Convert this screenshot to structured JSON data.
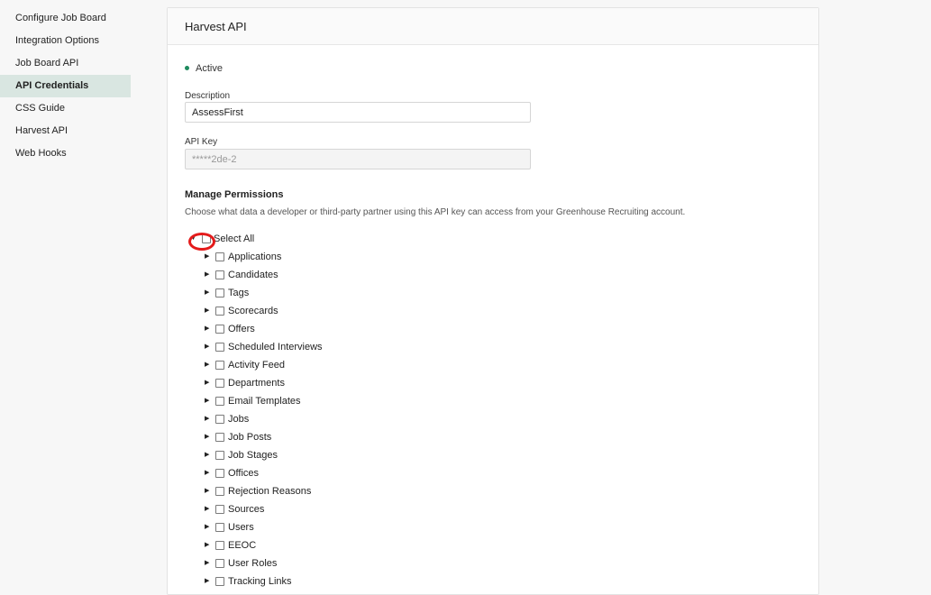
{
  "sidebar": {
    "items": [
      {
        "label": "Configure Job Board",
        "active": false
      },
      {
        "label": "Integration Options",
        "active": false
      },
      {
        "label": "Job Board API",
        "active": false
      },
      {
        "label": "API Credentials",
        "active": true
      },
      {
        "label": "CSS Guide",
        "active": false
      },
      {
        "label": "Harvest API",
        "active": false
      },
      {
        "label": "Web Hooks",
        "active": false
      }
    ]
  },
  "panel": {
    "title": "Harvest API",
    "status": "Active",
    "status_color": "#1f8a5e",
    "description": {
      "label": "Description",
      "value": "AssessFirst"
    },
    "api_key": {
      "label": "API Key",
      "value": "*****2de-2"
    },
    "permissions": {
      "title": "Manage Permissions",
      "description": "Choose what data a developer or third-party partner using this API key can access from your Greenhouse Recruiting account.",
      "select_all": "Select All",
      "items": [
        "Applications",
        "Candidates",
        "Tags",
        "Scorecards",
        "Offers",
        "Scheduled Interviews",
        "Activity Feed",
        "Departments",
        "Email Templates",
        "Jobs",
        "Job Posts",
        "Job Stages",
        "Offices",
        "Rejection Reasons",
        "Sources",
        "Users",
        "EEOC",
        "User Roles",
        "Tracking Links"
      ]
    }
  },
  "icons": {
    "expanded": "triangle-down",
    "collapsed": "triangle-right"
  },
  "colors": {
    "active_sidebar_bg": "#d9e6e1",
    "annotation_circle": "#e41b1b"
  }
}
